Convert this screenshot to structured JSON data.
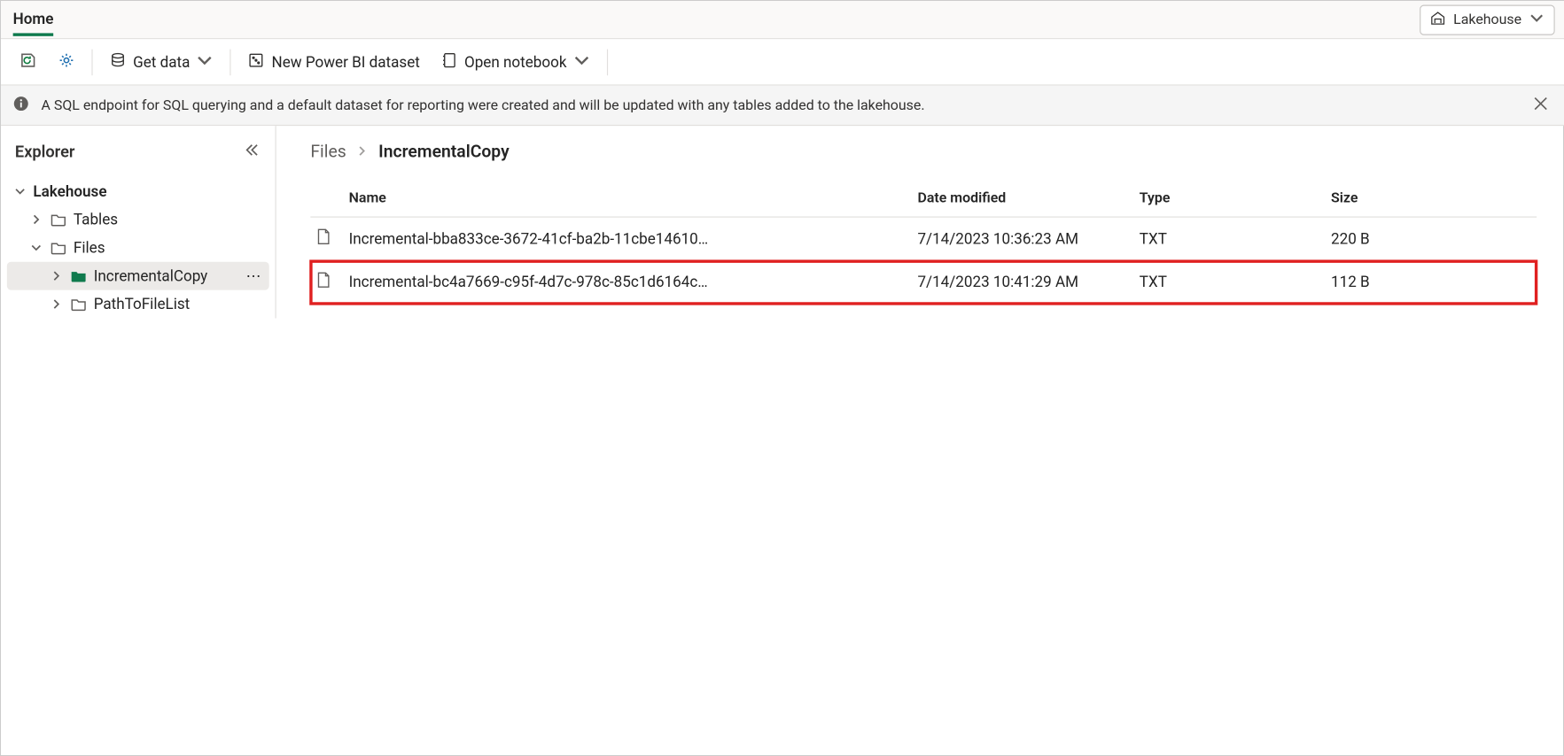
{
  "tabs": {
    "home": "Home"
  },
  "mode_button": {
    "label": "Lakehouse"
  },
  "toolbar": {
    "get_data": "Get data",
    "new_dataset": "New Power BI dataset",
    "open_notebook": "Open notebook"
  },
  "info_banner": "A SQL endpoint for SQL querying and a default dataset for reporting were created and will be updated with any tables added to the lakehouse.",
  "explorer": {
    "title": "Explorer",
    "root": "Lakehouse",
    "tables": "Tables",
    "files": "Files",
    "items": {
      "incremental_copy": "IncrementalCopy",
      "path_to_file_list": "PathToFileList"
    }
  },
  "breadcrumb": {
    "root": "Files",
    "current": "IncrementalCopy"
  },
  "table": {
    "headers": {
      "name": "Name",
      "modified": "Date modified",
      "type": "Type",
      "size": "Size"
    },
    "rows": [
      {
        "name": "Incremental-bba833ce-3672-41cf-ba2b-11cbe14610…",
        "modified": "7/14/2023 10:36:23 AM",
        "type": "TXT",
        "size": "220 B",
        "highlighted": false
      },
      {
        "name": "Incremental-bc4a7669-c95f-4d7c-978c-85c1d6164c…",
        "modified": "7/14/2023 10:41:29 AM",
        "type": "TXT",
        "size": "112 B",
        "highlighted": true
      }
    ]
  }
}
